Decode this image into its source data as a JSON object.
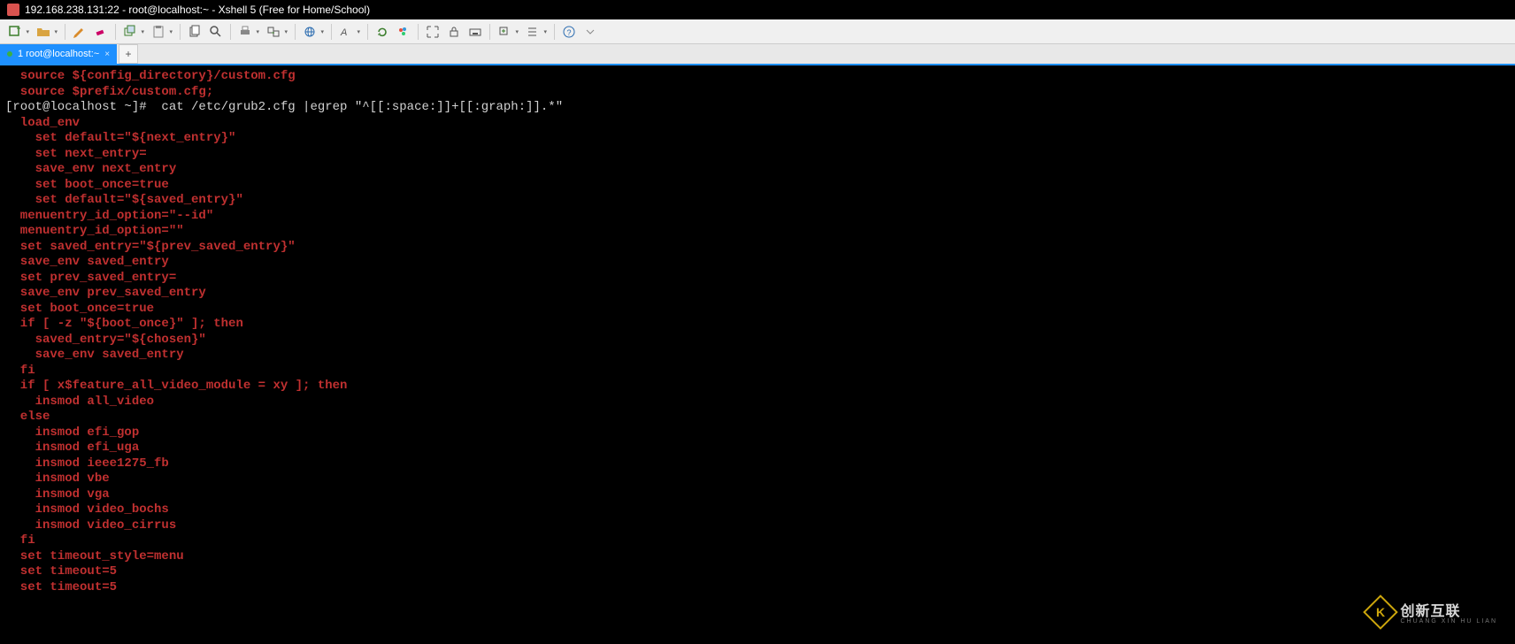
{
  "window": {
    "title": "192.168.238.131:22 - root@localhost:~ - Xshell 5 (Free for Home/School)"
  },
  "toolbar": {
    "icons": [
      "new-session",
      "open",
      "pencil",
      "eraser",
      "copy-session",
      "copy-down",
      "copy",
      "find",
      "print-down",
      "transfer-down",
      "globe-down",
      "font-down",
      "refresh",
      "palette",
      "fullscreen",
      "lock",
      "keyboard",
      "add-down",
      "list-down",
      "help"
    ]
  },
  "tabs": {
    "active": {
      "label": "1 root@localhost:~"
    },
    "add": "+"
  },
  "terminal": {
    "lines": [
      {
        "t": "r",
        "s": 1,
        "v": "source ${config_directory}/custom.cfg"
      },
      {
        "t": "r",
        "s": 1,
        "v": "source $prefix/custom.cfg;"
      },
      {
        "t": "w",
        "s": 0,
        "v": "[root@localhost ~]#  cat /etc/grub2.cfg |egrep \"^[[:space:]]+[[:graph:]].*\""
      },
      {
        "t": "r",
        "s": 1,
        "v": "load_env"
      },
      {
        "t": "r",
        "s": 2,
        "v": "set default=\"${next_entry}\""
      },
      {
        "t": "r",
        "s": 2,
        "v": "set next_entry="
      },
      {
        "t": "r",
        "s": 2,
        "v": "save_env next_entry"
      },
      {
        "t": "r",
        "s": 2,
        "v": "set boot_once=true"
      },
      {
        "t": "r",
        "s": 2,
        "v": "set default=\"${saved_entry}\""
      },
      {
        "t": "r",
        "s": 1,
        "v": "menuentry_id_option=\"--id\""
      },
      {
        "t": "r",
        "s": 1,
        "v": "menuentry_id_option=\"\""
      },
      {
        "t": "r",
        "s": 1,
        "v": "set saved_entry=\"${prev_saved_entry}\""
      },
      {
        "t": "r",
        "s": 1,
        "v": "save_env saved_entry"
      },
      {
        "t": "r",
        "s": 1,
        "v": "set prev_saved_entry="
      },
      {
        "t": "r",
        "s": 1,
        "v": "save_env prev_saved_entry"
      },
      {
        "t": "r",
        "s": 1,
        "v": "set boot_once=true"
      },
      {
        "t": "r",
        "s": 1,
        "v": "if [ -z \"${boot_once}\" ]; then"
      },
      {
        "t": "r",
        "s": 2,
        "v": "saved_entry=\"${chosen}\""
      },
      {
        "t": "r",
        "s": 2,
        "v": "save_env saved_entry"
      },
      {
        "t": "r",
        "s": 1,
        "v": "fi"
      },
      {
        "t": "r",
        "s": 1,
        "v": "if [ x$feature_all_video_module = xy ]; then"
      },
      {
        "t": "r",
        "s": 2,
        "v": "insmod all_video"
      },
      {
        "t": "r",
        "s": 1,
        "v": "else"
      },
      {
        "t": "r",
        "s": 2,
        "v": "insmod efi_gop"
      },
      {
        "t": "r",
        "s": 2,
        "v": "insmod efi_uga"
      },
      {
        "t": "r",
        "s": 2,
        "v": "insmod ieee1275_fb"
      },
      {
        "t": "r",
        "s": 2,
        "v": "insmod vbe"
      },
      {
        "t": "r",
        "s": 2,
        "v": "insmod vga"
      },
      {
        "t": "r",
        "s": 2,
        "v": "insmod video_bochs"
      },
      {
        "t": "r",
        "s": 2,
        "v": "insmod video_cirrus"
      },
      {
        "t": "r",
        "s": 1,
        "v": "fi"
      },
      {
        "t": "r",
        "s": 1,
        "v": "set timeout_style=menu"
      },
      {
        "t": "r",
        "s": 1,
        "v": "set timeout=5"
      },
      {
        "t": "r",
        "s": 1,
        "v": "set timeout=5"
      }
    ]
  },
  "watermark": {
    "brand": "创新互联",
    "sub": "CHUANG XIN HU LIAN",
    "logo": "K"
  }
}
